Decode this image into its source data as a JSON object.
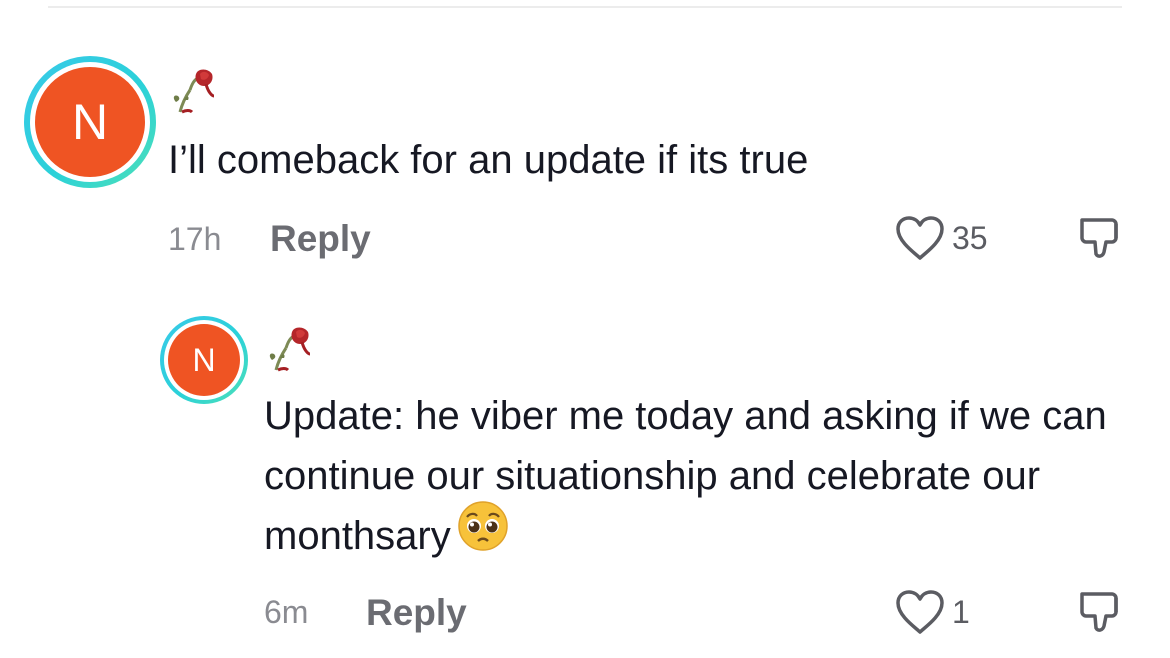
{
  "comments": [
    {
      "avatar_letter": "N",
      "username": "🥀",
      "text": "I’ll comeback for an update if its true",
      "time": "17h",
      "reply_label": "Reply",
      "likes": "35",
      "avatar_color": "#ef5423",
      "ring_color": "#39c9e8"
    },
    {
      "avatar_letter": "N",
      "username": "🥀",
      "text": "Update: he viber me today and asking if we can continue our situationship and celebrate our monthsary",
      "emoji": "🥺",
      "time": "6m",
      "reply_label": "Reply",
      "likes": "1",
      "avatar_color": "#ef5423",
      "ring_color": "#39c9e8"
    }
  ],
  "icons": {
    "like": "heart-outline-icon",
    "dislike": "thumbs-down-icon",
    "username_emoji": "wilted-rose-emoji",
    "reaction_emoji": "pleading-face-emoji"
  }
}
